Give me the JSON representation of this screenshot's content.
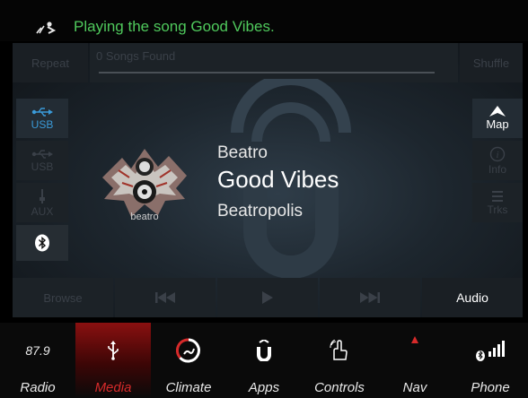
{
  "status": {
    "message": "Playing the song Good Vibes."
  },
  "controls": {
    "repeat_label": "Repeat",
    "shuffle_label": "Shuffle",
    "songs_found": "0 Songs Found"
  },
  "sources": {
    "usb_1": "USB",
    "usb_2": "USB",
    "aux": "AUX"
  },
  "right_buttons": {
    "map": "Map",
    "info": "Info",
    "tracks": "Trks"
  },
  "now_playing": {
    "artist": "Beatro",
    "title": "Good Vibes",
    "album": "Beatropolis",
    "album_art_text": "beatro"
  },
  "transport": {
    "browse": "Browse",
    "audio": "Audio"
  },
  "nav": {
    "radio_freq": "87.9",
    "radio": "Radio",
    "media": "Media",
    "climate": "Climate",
    "apps": "Apps",
    "controls": "Controls",
    "nav": "Nav",
    "phone": "Phone"
  },
  "colors": {
    "status_green": "#4fc95c",
    "usb_active_blue": "#3a9ad8",
    "media_red": "#d62a2a"
  }
}
